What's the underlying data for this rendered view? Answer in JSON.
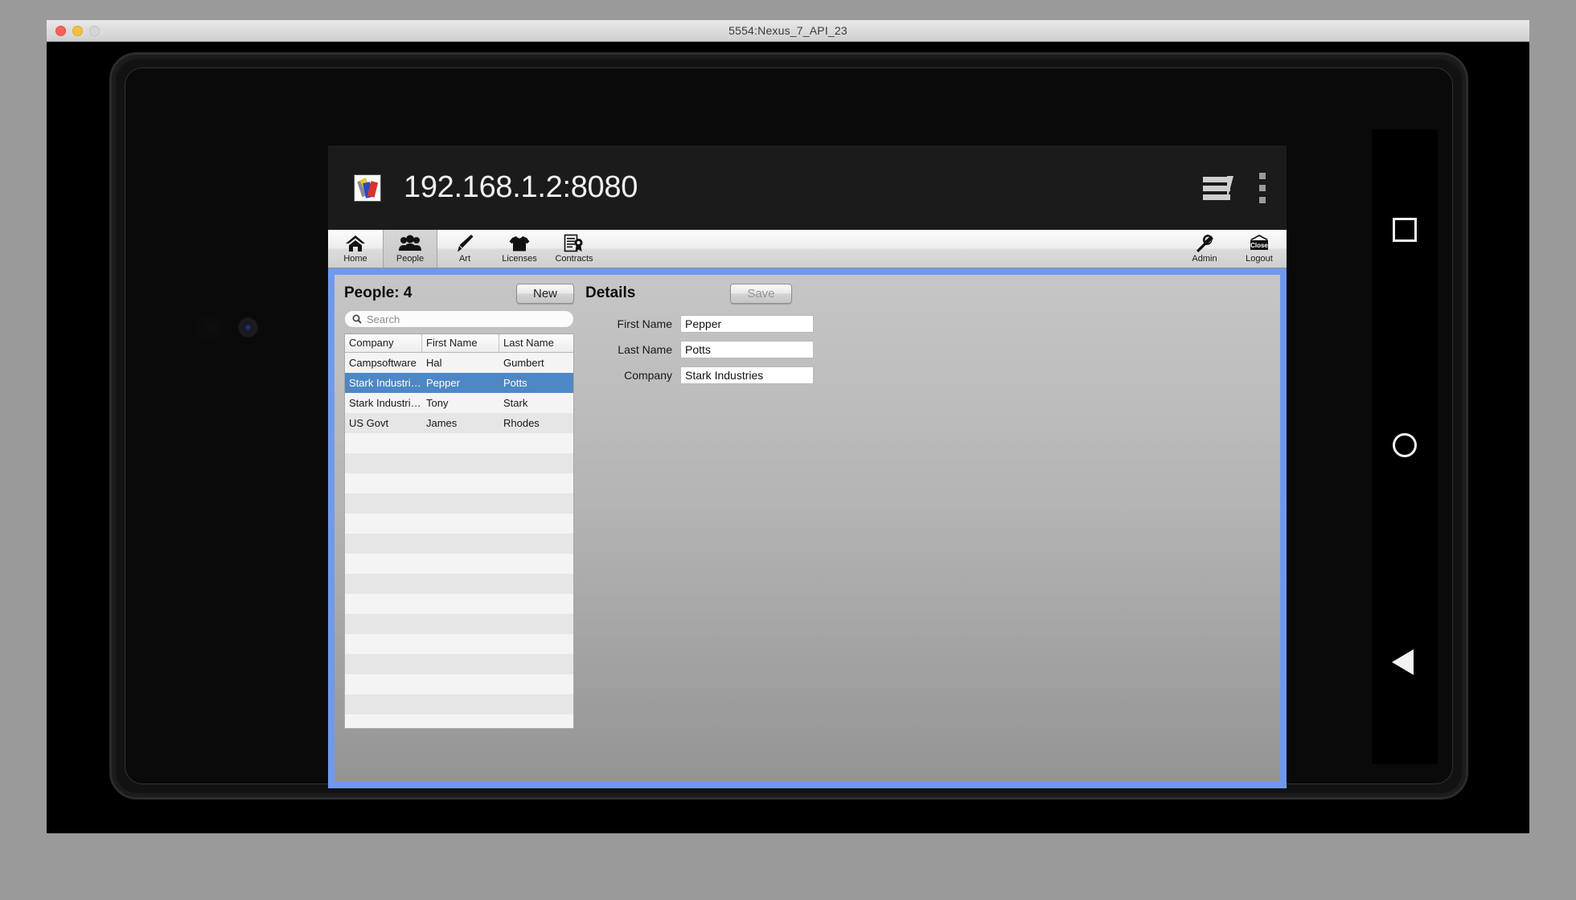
{
  "window": {
    "title": "5554:Nexus_7_API_23",
    "traffic_lights": [
      "close",
      "minimize",
      "zoom"
    ]
  },
  "browser": {
    "url": "192.168.1.2:8080",
    "favicon": "paint-palette-icon",
    "tabs_icon": "stacked-tabs-icon",
    "menu_icon": "three-dot-menu-icon"
  },
  "toolbar": {
    "items": [
      {
        "label": "Home",
        "icon": "home-icon",
        "selected": false
      },
      {
        "label": "People",
        "icon": "people-icon",
        "selected": true
      },
      {
        "label": "Art",
        "icon": "paintbrush-icon",
        "selected": false
      },
      {
        "label": "Licenses",
        "icon": "tshirt-icon",
        "selected": false
      },
      {
        "label": "Contracts",
        "icon": "contract-seal-icon",
        "selected": false
      }
    ],
    "right_items": [
      {
        "label": "Admin",
        "icon": "wrench-icon"
      },
      {
        "label": "Logout",
        "icon": "close-sign-icon"
      }
    ],
    "logout_sign_text": "Close"
  },
  "list_panel": {
    "title": "People: 4",
    "new_button": "New",
    "search_placeholder": "Search",
    "search_value": "",
    "search_icon": "search-icon",
    "columns": [
      "Company",
      "First Name",
      "Last Name"
    ],
    "rows": [
      {
        "company": "Campsoftware",
        "first": "Hal",
        "last": "Gumbert",
        "selected": false
      },
      {
        "company": "Stark Industri…",
        "first": "Pepper",
        "last": "Potts",
        "selected": true
      },
      {
        "company": "Stark Industri…",
        "first": "Tony",
        "last": "Stark",
        "selected": false
      },
      {
        "company": "US Govt",
        "first": "James",
        "last": "Rhodes",
        "selected": false
      }
    ],
    "empty_row_count": 16
  },
  "details_panel": {
    "title": "Details",
    "save_button": "Save",
    "save_enabled": false,
    "fields": [
      {
        "label": "First Name",
        "value": "Pepper"
      },
      {
        "label": "Last Name",
        "value": "Potts"
      },
      {
        "label": "Company",
        "value": "Stark Industries"
      }
    ]
  },
  "android_nav": {
    "recents": "square-icon",
    "home": "circle-icon",
    "back": "triangle-back-icon"
  },
  "colors": {
    "selection_blue": "#4e88c4",
    "app_frame_blue": "#7099ed",
    "panel_grey": "#b4b4b4",
    "browser_bar": "#1b1b1b"
  }
}
